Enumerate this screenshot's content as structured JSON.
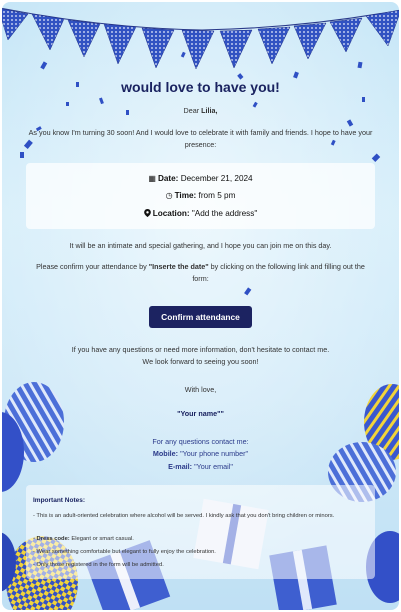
{
  "invitation": {
    "title": "would love to have you!",
    "greeting_prefix": "Dear ",
    "guest_name": "Lilia,",
    "intro": "As you know I'm turning 30 soon! And I would love to celebrate it with family and friends. I hope to have your presence:",
    "details": {
      "date_label": "Date:",
      "date_value": "December 21, 2024",
      "time_label": "Time:",
      "time_value": "from 5 pm",
      "location_label": "Location:",
      "location_value": "\"Add the address\""
    },
    "gathering_text": "It will be an intimate and special gathering, and I hope you can join me on this day.",
    "confirm_prefix": "Please confirm your attendance by ",
    "confirm_date": "\"Inserte the date\"",
    "confirm_suffix": " by clicking on the following link and filling out the form:",
    "confirm_button": "Confirm attendance",
    "questions_line1": "If you have any questions or need more information, don't hesitate to contact me.",
    "questions_line2": "We look forward to seeing you soon!",
    "closing": "With love,",
    "signature": "\"Your name\"\"",
    "contact_heading": "For any questions contact me:",
    "mobile_label": "Mobile:",
    "mobile_value": "\"Your phone number\"",
    "email_label": "E-mail:",
    "email_value": "\"Your email\""
  },
  "notes": {
    "heading": "Important Notes:",
    "item1": "- This is an adult-oriented celebration where alcohol will be served. I kindly ask that you don't bring children or minors.",
    "item2_label": "Dress code:",
    "item2_text": " Elegant or smart casual.",
    "item3": "- Wear something comfortable but elegant to fully enjoy the celebration.",
    "item4": "- Only those registered in the form will be admitted."
  },
  "colors": {
    "accent": "#1c2361",
    "balloon_blue": "#3b54c8",
    "balloon_yellow": "#f2d43a"
  },
  "icons": {
    "date": "calendar-icon",
    "time": "clock-icon",
    "location": "map-pin-icon"
  }
}
